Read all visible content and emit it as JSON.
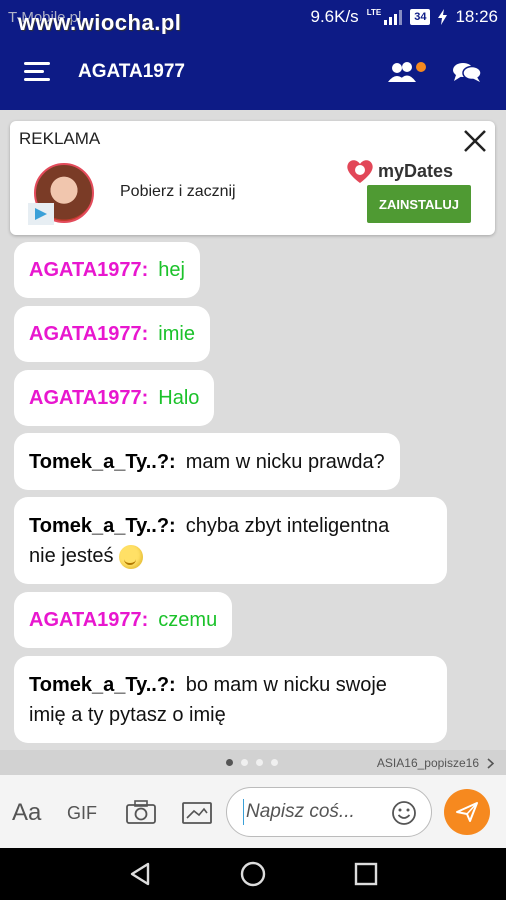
{
  "status_bar": {
    "carrier": "T-Mobile.pl",
    "watermark": "www.wiocha.pl",
    "net_speed": "9.6K/s",
    "network": "LTE",
    "battery": "34",
    "time": "18:26"
  },
  "header": {
    "title": "AGATA1977"
  },
  "ad": {
    "label": "REKLAMA",
    "text": "Pobierz i zacznij",
    "brand": "myDates",
    "button": "ZAINSTALUJ"
  },
  "messages": [
    {
      "author": "AGATA1977:",
      "text": "hej"
    },
    {
      "author": "AGATA1977:",
      "text": "imie"
    },
    {
      "author": "AGATA1977:",
      "text": "Halo"
    },
    {
      "author": "Tomek_a_Ty..?:",
      "text": "mam w nicku prawda?"
    },
    {
      "author": "Tomek_a_Ty..?:",
      "text_line1": "chyba zbyt inteligentna",
      "text_line2": "nie jesteś"
    },
    {
      "author": "AGATA1977:",
      "text": "czemu"
    },
    {
      "author": "Tomek_a_Ty..?:",
      "text_line1": "bo mam w nicku swoje",
      "text_line2": "imię a ty pytasz o imię"
    }
  ],
  "strip": {
    "promo_user": "ASIA16_popisze16"
  },
  "input": {
    "font_label": "Aa",
    "gif_label": "GIF",
    "placeholder": "Napisz coś..."
  },
  "colors": {
    "header": "#0d1b86",
    "agata": "#e817cf",
    "agata_text": "#1bc22a",
    "send": "#f6891f",
    "install": "#4f9a33"
  }
}
